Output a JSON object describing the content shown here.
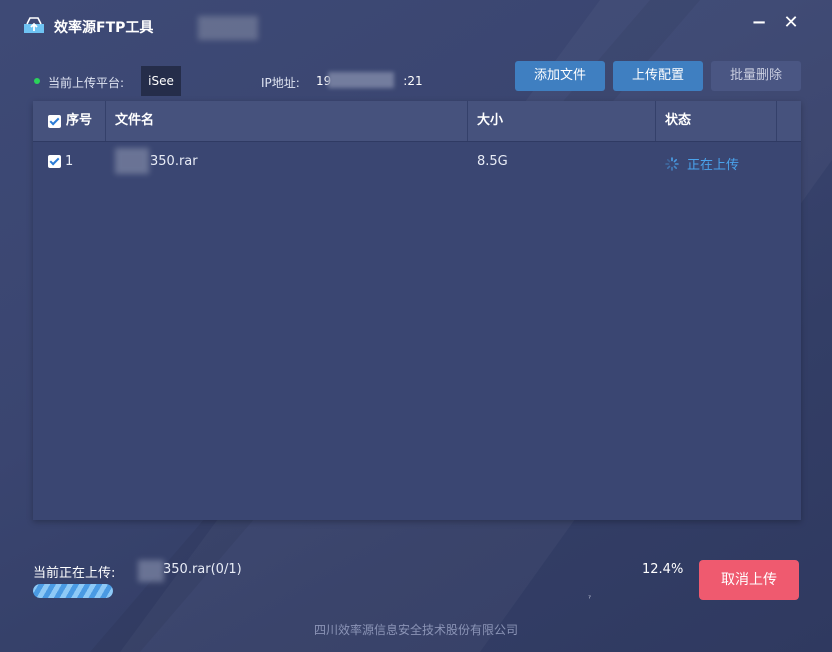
{
  "app": {
    "title": "效率源FTP工具",
    "minimize_glyph": "−",
    "close_glyph": "✕"
  },
  "platform": {
    "label": "当前上传平台:",
    "value": "iSee",
    "ip_label": "IP地址:",
    "ip_prefix": "19",
    "ip_suffix": ":21",
    "status_color": "#2ad35a"
  },
  "toolbar": {
    "add_files": "添加文件",
    "upload_config": "上传配置",
    "batch_delete": "批量删除"
  },
  "table": {
    "headers": {
      "seq": "序号",
      "name": "文件名",
      "size": "大小",
      "status": "状态"
    },
    "rows": [
      {
        "seq": "1",
        "name": "350.rar",
        "size": "8.5G",
        "status": "正在上传",
        "checked": true
      }
    ]
  },
  "footer_status": {
    "current_label": "当前正在上传:",
    "current_file": "350.rar(0/1)",
    "percent": "12.4%",
    "progress": 0.124,
    "cancel": "取消上传",
    "mark": "ˀ"
  },
  "company": "四川效率源信息安全技术股份有限公司",
  "colors": {
    "accent": "#3f7fc1",
    "danger": "#ef5a6f",
    "uploading": "#4aa3ec"
  }
}
